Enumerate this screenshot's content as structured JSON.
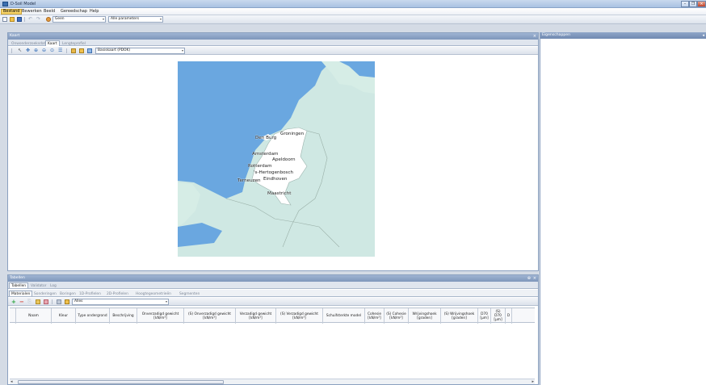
{
  "window": {
    "title": "D-Soil Model",
    "minimize_glyph": "–",
    "restore_glyph": "❐",
    "close_glyph": "×"
  },
  "menubar": {
    "items": [
      "Bestand",
      "Bewerken",
      "Beeld",
      "Gereedschap",
      "Help"
    ]
  },
  "toolbar": {
    "layer_combo": "Geen",
    "param_combo": "Alle parameters"
  },
  "map_pane": {
    "title": "Kaart",
    "tabs": [
      "Onwonderzoeksdata",
      "Kaart",
      "Lengteprofiel"
    ],
    "active_tab": "Kaart",
    "basemap_combo": "Basiskaart (PDOK)",
    "cities": [
      "Groningen",
      "Den Burg",
      "Amsterdam",
      "Apeldoorn",
      "Rotterdam",
      "'s-Hertogenbosch",
      "Terneuzen",
      "Eindhoven",
      "Maastricht"
    ]
  },
  "tables_pane": {
    "title": "Tabellen",
    "pin_glyph": "⊕",
    "close_glyph": "×",
    "outer_tabs": [
      "Tabellen",
      "Validator",
      "Log"
    ],
    "inner_tabs": [
      "Materialen",
      "Sonderingen",
      "Boringen",
      "1D-Profielen",
      "2D-Profielen",
      "Hoogtegeometrieën",
      "Segmenten"
    ],
    "filter_combo": "Alles",
    "columns": [
      [
        "Naam"
      ],
      [
        "Kleur"
      ],
      [
        "Type ondergrond"
      ],
      [
        "Beschrijving"
      ],
      [
        "Onverzadigd gewicht",
        "[kN/m³]"
      ],
      [
        "(S) Onverzadigd gewicht",
        "[kN/m³]"
      ],
      [
        "Verzadigd gewicht",
        "[kN/m³]"
      ],
      [
        "(S) Verzadigd gewicht",
        "[kN/m³]"
      ],
      [
        "Schuifsterkte model"
      ],
      [
        "Cohesie",
        "[kN/m²]"
      ],
      [
        "(S) Cohesie",
        "[kN/m²]"
      ],
      [
        "Wrijvingshoek",
        "[graden]"
      ],
      [
        "(S) Wrijvingshoek",
        "[graden]"
      ],
      [
        "D70",
        "[µm]"
      ],
      [
        "(S) D70",
        "[µm]"
      ],
      [
        "D"
      ]
    ]
  },
  "props_pane": {
    "title": "Eigenschappen"
  },
  "colors": {
    "sea": "#6aa7e0",
    "land": "#d6ede6",
    "nl_land": "#ffffff",
    "header": "#8aa3c7",
    "menu_active": "#f7d469"
  }
}
